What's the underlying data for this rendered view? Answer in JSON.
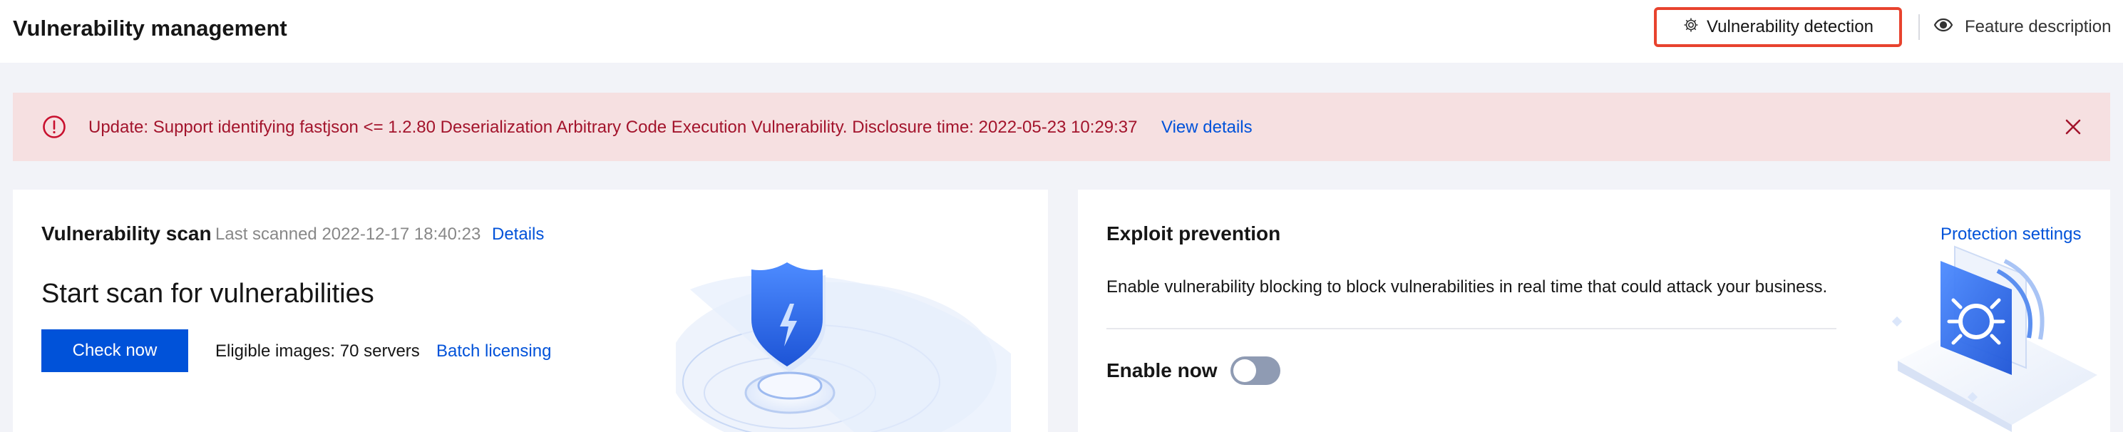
{
  "header": {
    "title": "Vulnerability management",
    "detect_button": "Vulnerability detection",
    "feature_description": "Feature description"
  },
  "alert": {
    "message": "Update: Support identifying fastjson <= 1.2.80 Deserialization Arbitrary Code Execution Vulnerability. Disclosure time: 2022-05-23 10:29:37",
    "link": "View details"
  },
  "scan_card": {
    "title": "Vulnerability scan",
    "last_scanned": "Last scanned 2022-12-17 18:40:23",
    "details_link": "Details",
    "heading": "Start scan for vulnerabilities",
    "check_button": "Check now",
    "eligible": "Eligible images: 70 servers",
    "batch_link": "Batch licensing"
  },
  "exploit_card": {
    "title": "Exploit prevention",
    "description": "Enable vulnerability blocking to block vulnerabilities in real time that could attack your business.",
    "enable_label": "Enable now",
    "toggle_on": false,
    "settings_link": "Protection settings"
  },
  "icons": {
    "gear": "gear-icon",
    "eye": "eye-icon",
    "alert": "alert-circle-icon",
    "close": "close-icon"
  },
  "colors": {
    "accent": "#0052d9",
    "alert_bg": "#f6e0e1",
    "alert_text": "#a3142c",
    "highlight_border": "#e8432e",
    "toggle_off": "#8f9bb3"
  }
}
